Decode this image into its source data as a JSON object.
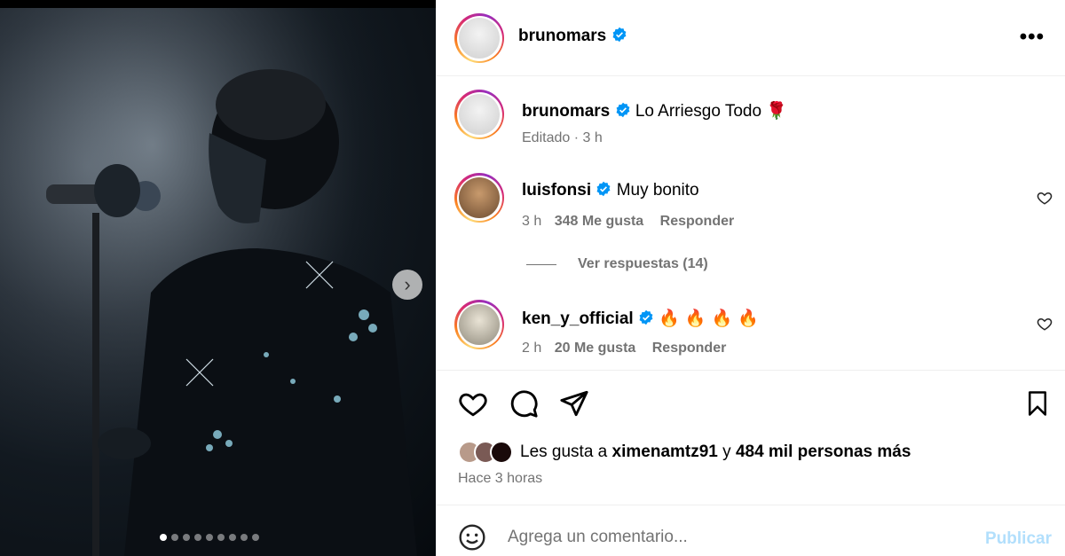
{
  "post": {
    "username": "brunomars",
    "more_label": "•••",
    "media_dots": 9,
    "active_dot": 0
  },
  "caption": {
    "username": "brunomars",
    "text": "Lo Arriesgo Todo 🌹",
    "meta": "Editado · 3 h"
  },
  "comments": [
    {
      "username": "luisfonsi",
      "text": "Muy bonito",
      "time": "3 h",
      "likes": "348 Me gusta",
      "reply": "Responder"
    },
    {
      "username": "ken_y_official",
      "text": "🔥🔥🔥🔥",
      "time": "2 h",
      "likes": "20 Me gusta",
      "reply": "Responder"
    }
  ],
  "view_replies": "Ver respuestas (14)",
  "likes": {
    "prefix": "Les gusta a",
    "user": "ximenamtz91",
    "connector": "y",
    "others": "484 mil personas más"
  },
  "time_ago": "Hace 3 horas",
  "comment_box": {
    "placeholder": "Agrega un comentario...",
    "post_label": "Publicar"
  },
  "colors": {
    "verified": "#0095f6",
    "muted": "#737373",
    "post_disabled": "#b2dffc"
  }
}
